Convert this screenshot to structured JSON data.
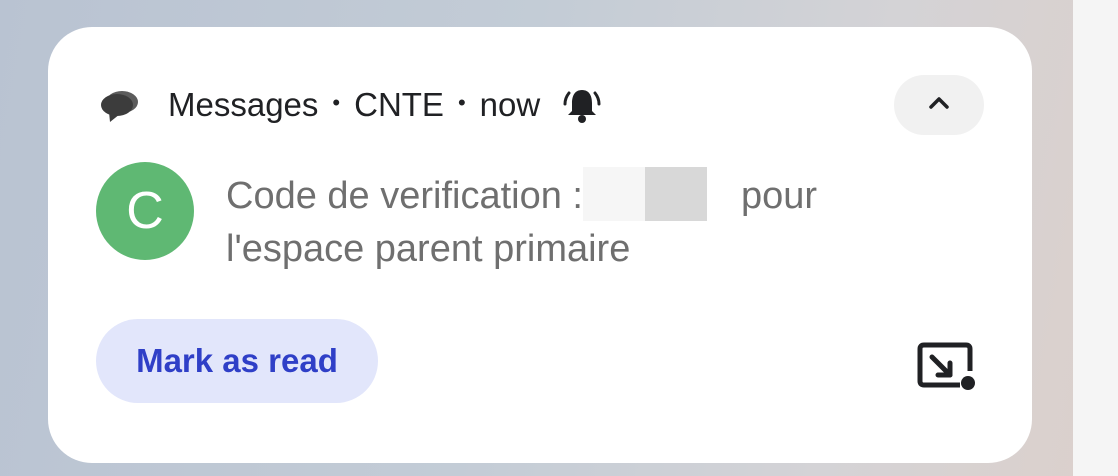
{
  "notification": {
    "app_name": "Messages",
    "sender": "CNTE",
    "time": "now",
    "separator": "•",
    "avatar_letter": "C",
    "message_prefix": "Code de verification :",
    "message_suffix": "pour",
    "message_line2": "l'espace parent primaire",
    "action_label": "Mark as read"
  },
  "icons": {
    "app": "chat-bubbles-icon",
    "bell": "alert-bell-icon",
    "expand": "chevron-up-icon",
    "pip": "picture-in-picture-icon"
  },
  "colors": {
    "avatar": "#5fb873",
    "action_bg": "#e2e6fb",
    "action_text": "#2f3fc7",
    "card": "#ffffff"
  }
}
